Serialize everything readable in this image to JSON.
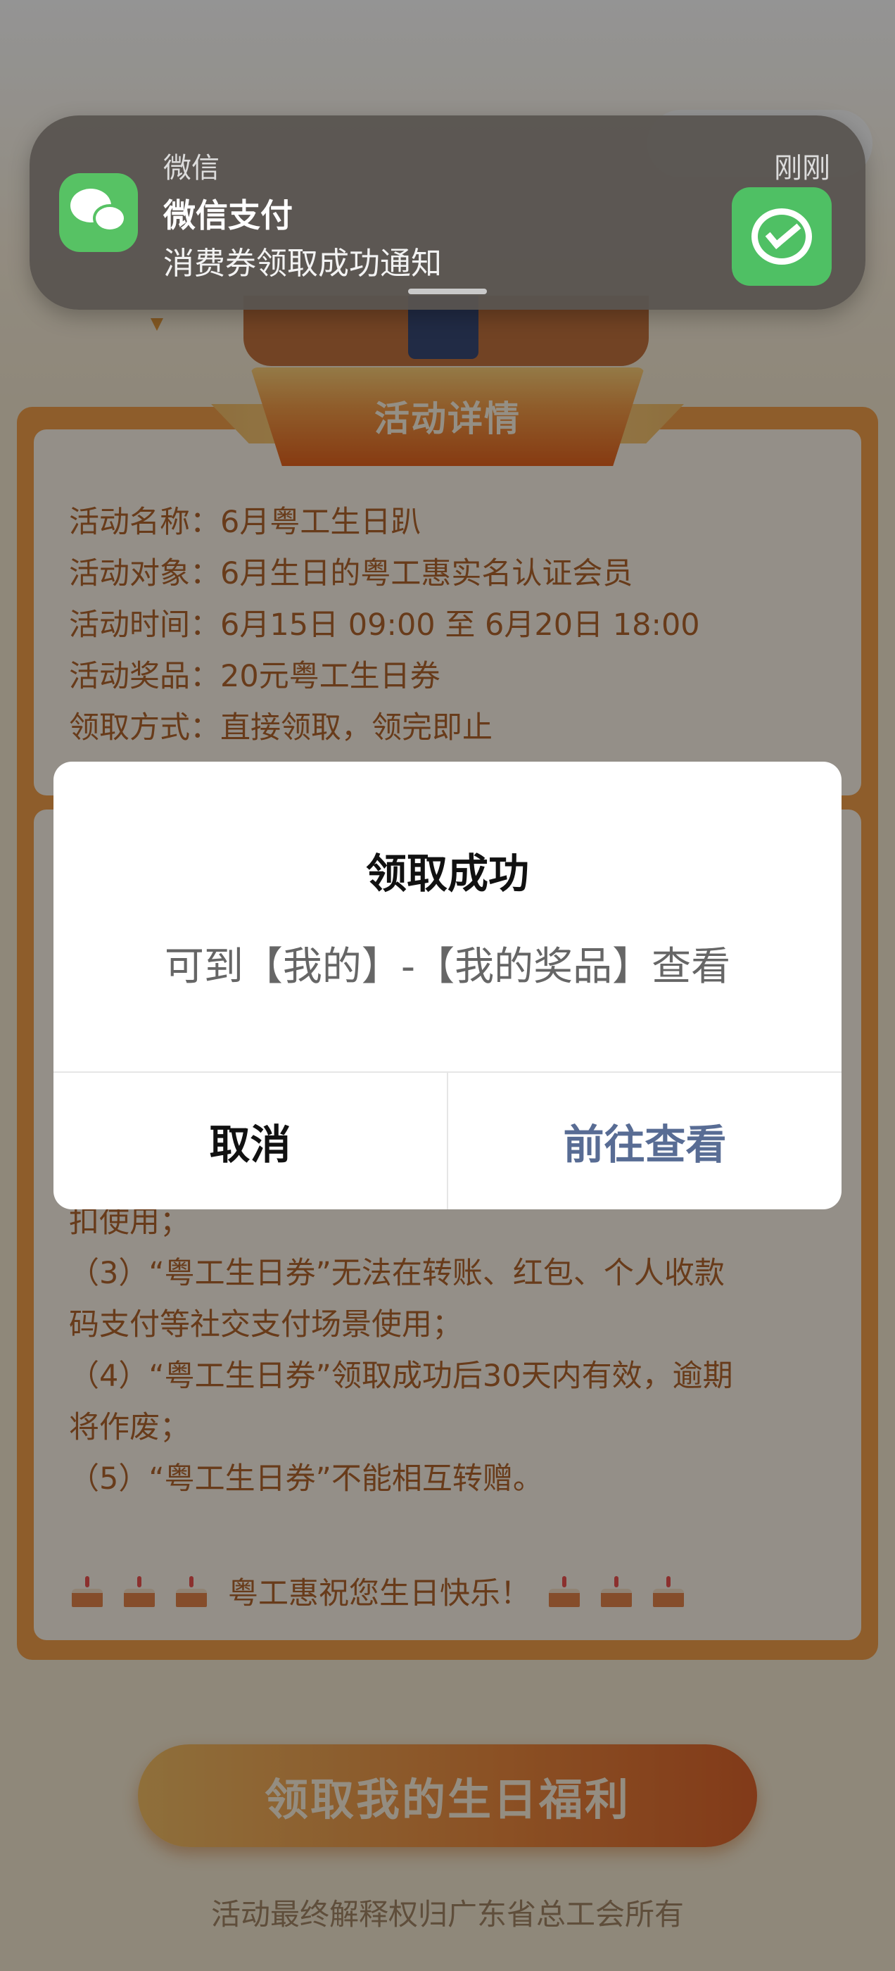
{
  "notification": {
    "app_name": "微信",
    "time": "刚刚",
    "title": "微信支付",
    "body": "消费券领取成功通知"
  },
  "activity": {
    "section_title": "活动详情",
    "info": [
      "活动名称：6月粤工生日趴",
      "活动对象：6月生日的粤工惠实名认证会员",
      "活动时间：6月15日 09:00 至 6月20日 18:00",
      "活动奖品：20元粤工生日券",
      "领取方式：直接领取，领完即止"
    ],
    "rules": [
      "扣使用；",
      "（3）“粤工生日券”无法在转账、红包、个人收款",
      "码支付等社交支付场景使用；",
      "（4）“粤工生日券”领取成功后30天内有效，逾期",
      "将作废；",
      "（5）“粤工生日券”不能相互转赠。"
    ],
    "greeting": "粤工惠祝您生日快乐！",
    "claim_button": "领取我的生日福利",
    "footer_note": "活动最终解释权归广东省总工会所有"
  },
  "dialog": {
    "title": "领取成功",
    "message": "可到【我的】-【我的奖品】查看",
    "cancel_label": "取消",
    "goto_label": "前往查看"
  },
  "colors": {
    "accent_orange": "#f4a04a",
    "body_text": "#b4662e",
    "dialog_link": "#586c94",
    "wechat_green": "#57c264"
  }
}
